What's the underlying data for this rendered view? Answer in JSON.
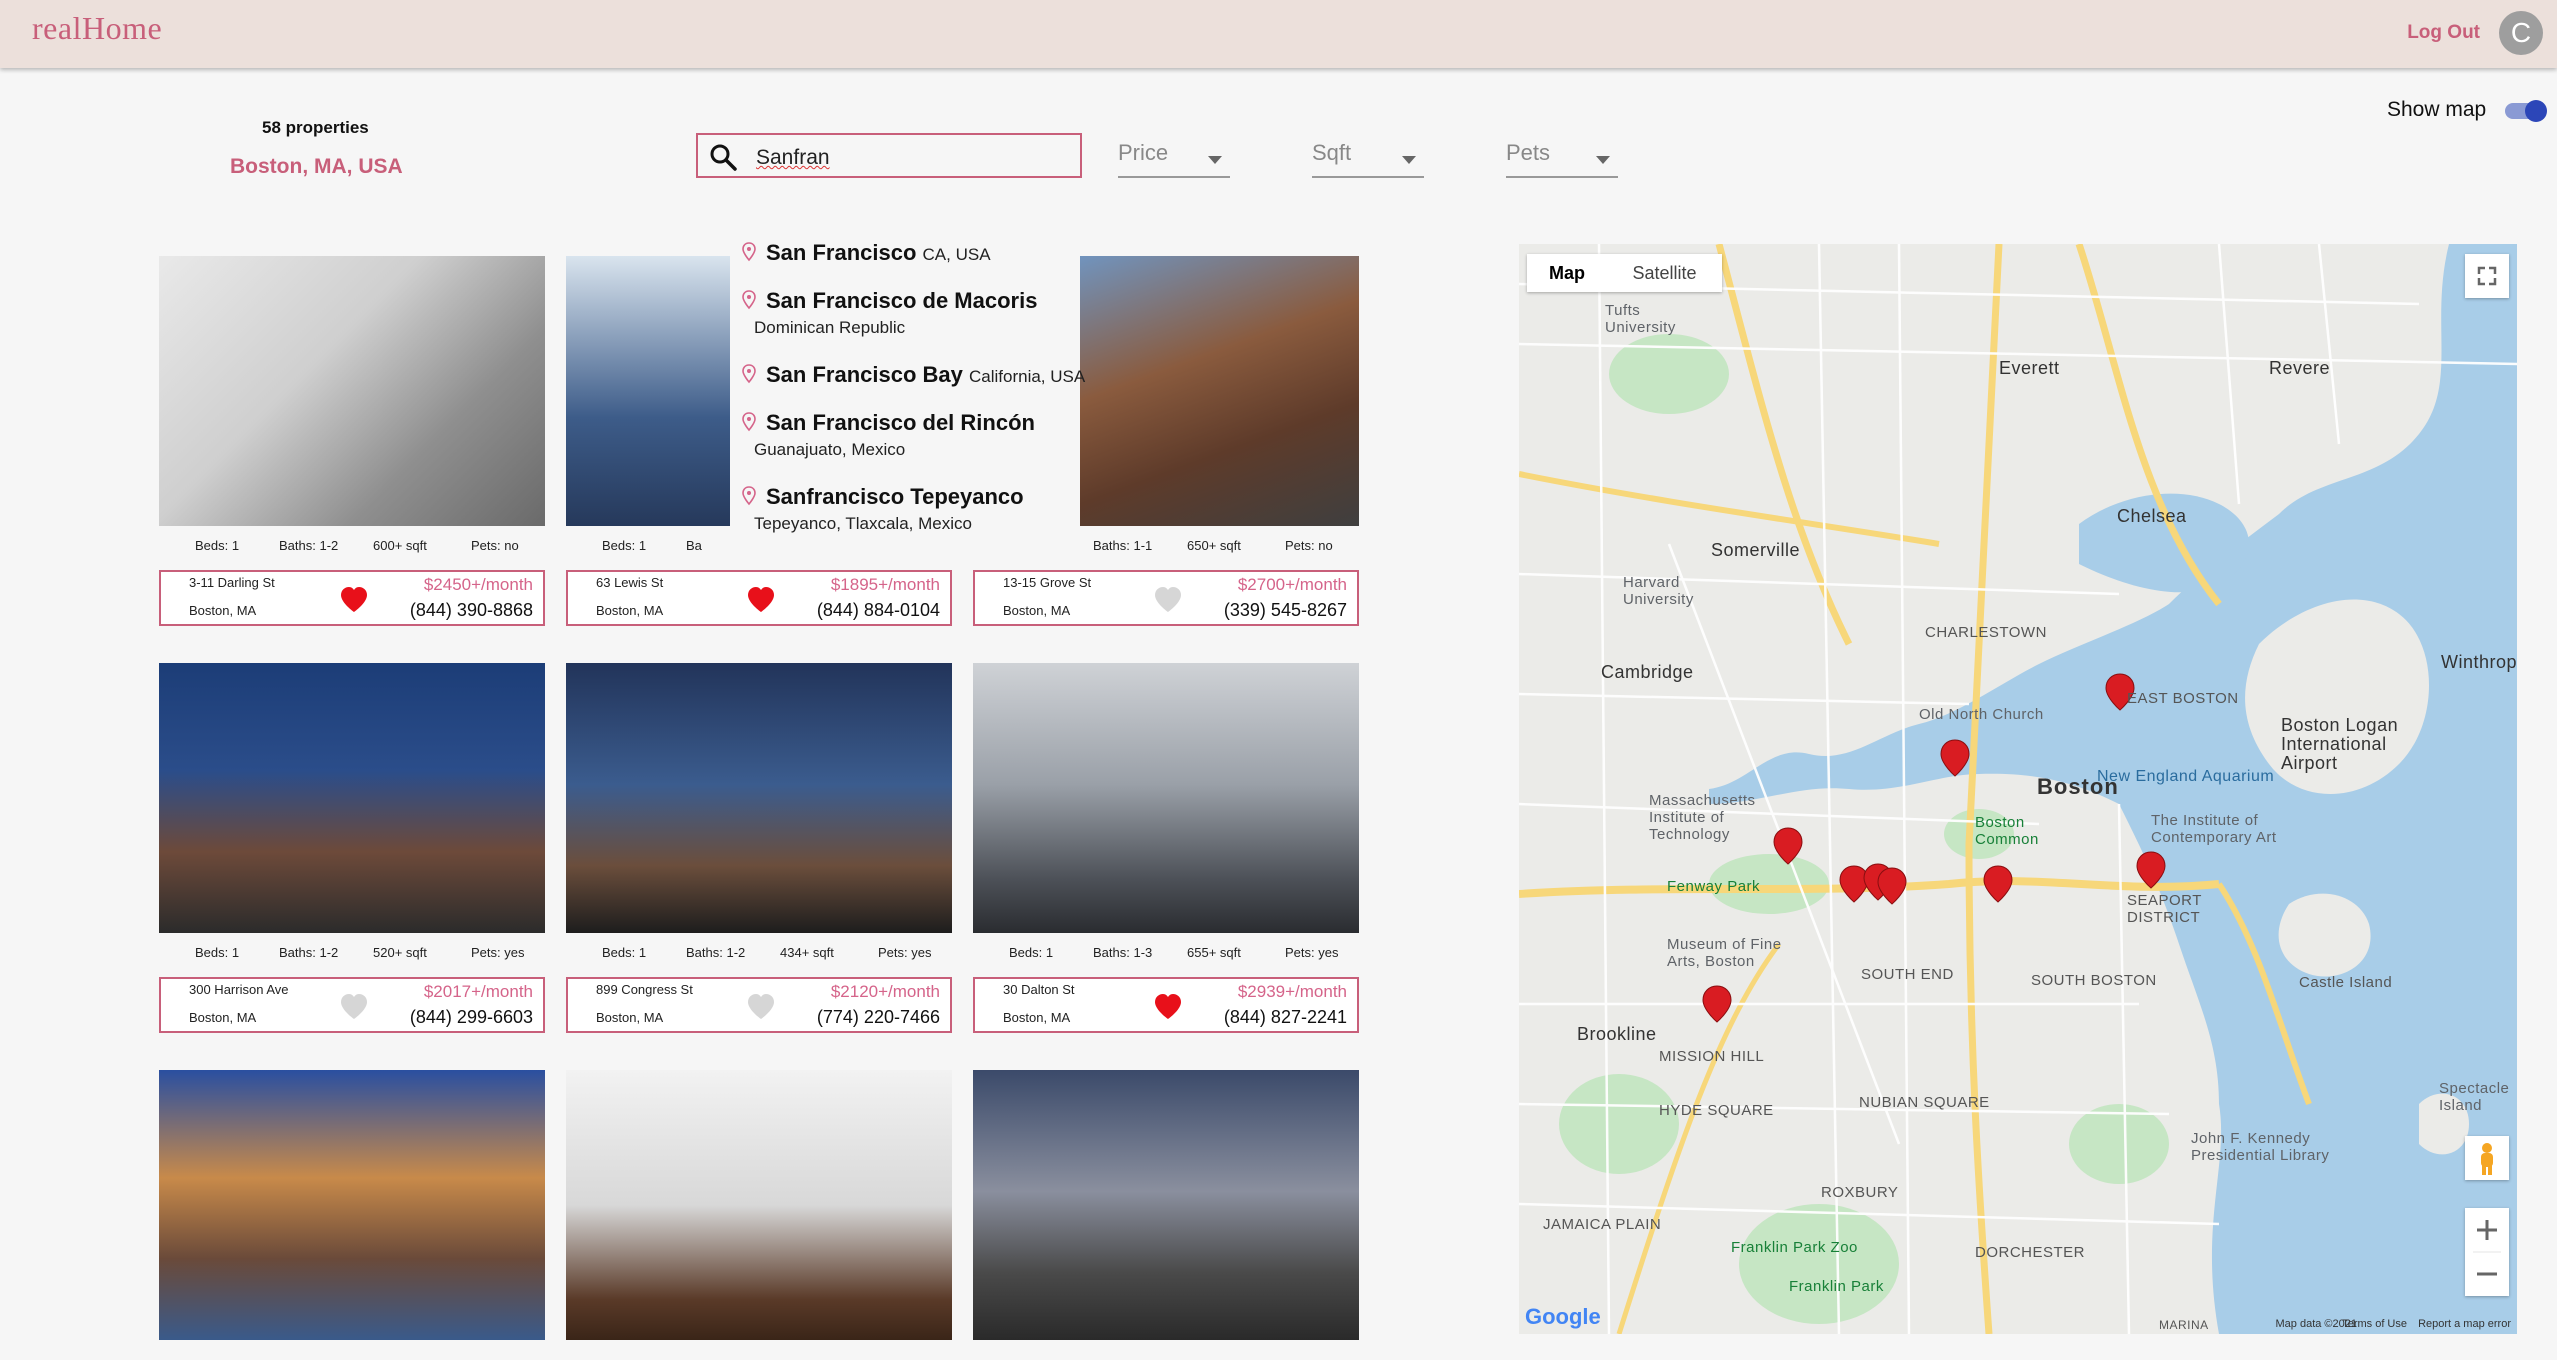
{
  "header": {
    "logo": "realHome",
    "logout_label": "Log Out",
    "avatar_initial": "C"
  },
  "summary": {
    "count": "58 properties",
    "location": "Boston, MA, USA"
  },
  "search": {
    "value": "Sanfran"
  },
  "filters": {
    "price": "Price",
    "sqft": "Sqft",
    "pets": "Pets"
  },
  "show_map": {
    "label": "Show map",
    "on": true
  },
  "suggestions": [
    {
      "name": "San Francisco",
      "detail": "CA, USA",
      "sub": ""
    },
    {
      "name": "San Francisco de Macoris",
      "detail": "",
      "sub": "Dominican Republic"
    },
    {
      "name": "San Francisco Bay",
      "detail": "California, USA",
      "sub": ""
    },
    {
      "name": "San Francisco del Rincón",
      "detail": "",
      "sub": "Guanajuato, Mexico"
    },
    {
      "name": "Sanfrancisco Tepeyanco",
      "detail": "",
      "sub": "Tepeyanco, Tlaxcala, Mexico"
    }
  ],
  "listings": [
    {
      "beds": "Beds: 1",
      "baths": "Baths: 1-2",
      "sqft": "600+ sqft",
      "pets": "Pets: no",
      "address": "3-11 Darling St",
      "city": "Boston, MA",
      "price": "$2450+/month",
      "phone": "(844) 390-8868",
      "favorite": true
    },
    {
      "beds": "Beds: 1",
      "baths": "Ba",
      "sqft": "",
      "pets": "",
      "address": "63 Lewis St",
      "city": "Boston, MA",
      "price": "$1895+/month",
      "phone": "(844) 884-0104",
      "favorite": true
    },
    {
      "beds": "",
      "baths": "Baths: 1-1",
      "sqft": "650+ sqft",
      "pets": "Pets: no",
      "address": "13-15 Grove St",
      "city": "Boston, MA",
      "price": "$2700+/month",
      "phone": "(339) 545-8267",
      "favorite": false
    },
    {
      "beds": "Beds: 1",
      "baths": "Baths: 1-2",
      "sqft": "520+ sqft",
      "pets": "Pets: yes",
      "address": "300 Harrison Ave",
      "city": "Boston, MA",
      "price": "$2017+/month",
      "phone": "(844) 299-6603",
      "favorite": false
    },
    {
      "beds": "Beds: 1",
      "baths": "Baths: 1-2",
      "sqft": "434+ sqft",
      "pets": "Pets: yes",
      "address": "899 Congress St",
      "city": "Boston, MA",
      "price": "$2120+/month",
      "phone": "(774) 220-7466",
      "favorite": false
    },
    {
      "beds": "Beds: 1",
      "baths": "Baths: 1-3",
      "sqft": "655+ sqft",
      "pets": "Pets: yes",
      "address": "30 Dalton St",
      "city": "Boston, MA",
      "price": "$2939+/month",
      "phone": "(844) 827-2241",
      "favorite": true
    },
    {
      "beds": "",
      "baths": "",
      "sqft": "",
      "pets": "",
      "address": "",
      "city": "",
      "price": "",
      "phone": "",
      "favorite": false
    },
    {
      "beds": "",
      "baths": "",
      "sqft": "",
      "pets": "",
      "address": "",
      "city": "",
      "price": "",
      "phone": "",
      "favorite": false
    },
    {
      "beds": "",
      "baths": "",
      "sqft": "",
      "pets": "",
      "address": "",
      "city": "",
      "price": "",
      "phone": "",
      "favorite": false
    }
  ],
  "map": {
    "tab_map": "Map",
    "tab_satellite": "Satellite",
    "labels": {
      "somerville": "Somerville",
      "cambridge": "Cambridge",
      "boston": "Boston",
      "brookline": "Brookline",
      "chelsea": "Chelsea",
      "everett": "Everett",
      "revere": "Revere",
      "winthrop": "Winthrop",
      "logan": "Boston Logan\nInternational\nAirport",
      "castle": "Castle Island",
      "seaport": "SEAPORT\nDISTRICT",
      "south_boston": "SOUTH BOSTON",
      "south_end": "SOUTH END",
      "roxbury": "ROXBURY",
      "fenway": "Fenway Park",
      "mit": "Massachusetts\nInstitute of\nTechnology",
      "harvard": "Harvard\nUniversity",
      "tufts": "Tufts\nUniversity",
      "aquarium": "New England Aquarium",
      "franklin": "Franklin Park Zoo",
      "jfk": "John F. Kennedy\nPresidential Library",
      "jamaica": "JAMAICA PLAIN",
      "dorchester": "DORCHESTER",
      "east_boston": "EAST BOSTON",
      "charlestown": "CHARLESTOWN",
      "mission_hill": "MISSION HILL",
      "hyde_square": "HYDE SQUARE",
      "nubian": "NUBIAN SQUARE",
      "north_end": "Old North Church",
      "common": "Boston\nCommon",
      "ica": "The Institute of\nContemporary Art",
      "mfa": "Museum of Fine\nArts, Boston",
      "spectacle": "Spectacle\nIsland",
      "franklin_park": "Franklin Park",
      "marina": "MARINA"
    },
    "footer_data": "Map data ©2021",
    "footer_terms": "Terms of Use",
    "footer_report": "Report a map error",
    "google": "Google"
  },
  "colors": {
    "accent": "#c85f7a",
    "header_bg": "#ece0db",
    "heart_red": "#e8101a",
    "heart_grey": "#d6d6d6",
    "pin_red": "#d91c22"
  }
}
